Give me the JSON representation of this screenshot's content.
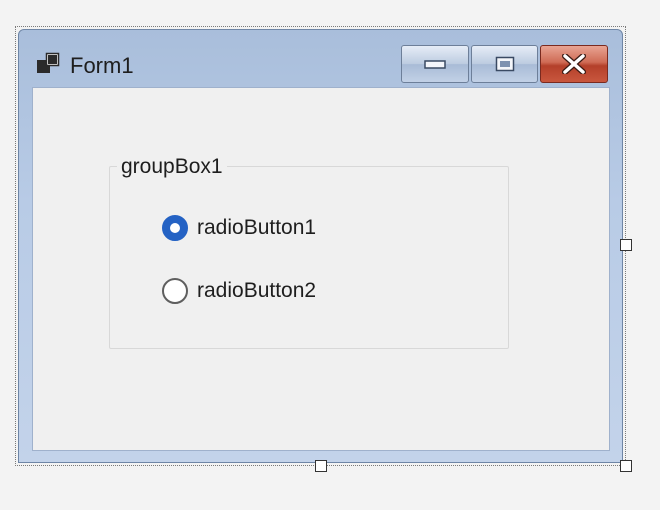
{
  "window": {
    "title": "Form1",
    "icon": "form-icon",
    "minimize_icon": "minimize-icon",
    "maximize_icon": "maximize-icon",
    "close_icon": "close-icon"
  },
  "group_box": {
    "title": "groupBox1"
  },
  "radios": [
    {
      "label": "radioButton1",
      "checked": true
    },
    {
      "label": "radioButton2",
      "checked": false
    }
  ],
  "colors": {
    "accent": "#2462c4",
    "close_button": "#c9573e",
    "title_bar": "#b8cbe6",
    "client_background": "#f0f0f0"
  }
}
